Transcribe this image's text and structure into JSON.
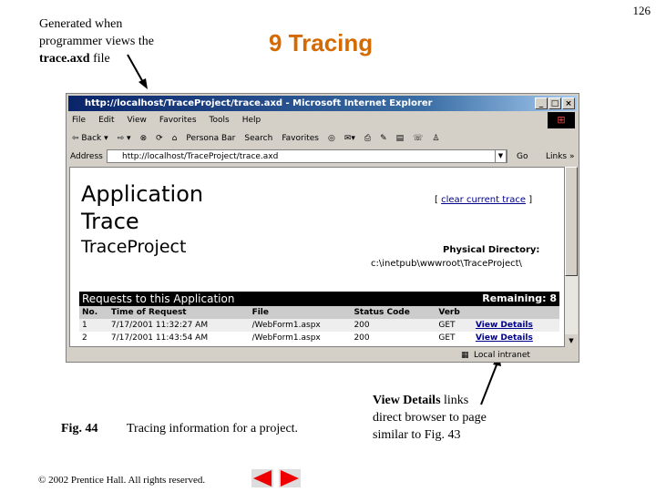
{
  "slide": {
    "page_number": "126",
    "title": "9  Tracing",
    "note_top": [
      "Generated when",
      "programmer views the"
    ],
    "note_top_bold": "trace.axd",
    "note_top_end": " file",
    "fig_label": "Fig. 44",
    "fig_caption": "Tracing information for a project.",
    "note_right_bold": "View Details",
    "note_right": [
      " links",
      "direct browser to page",
      "similar to Fig. 43"
    ],
    "copyright": "© 2002 Prentice Hall.  All rights reserved."
  },
  "browser": {
    "title": "http://localhost/TraceProject/trace.axd - Microsoft Internet Explorer",
    "menu": [
      "File",
      "Edit",
      "View",
      "Favorites",
      "Tools",
      "Help"
    ],
    "toolbar": [
      "⇦ Back ▾",
      "⇨ ▾",
      "⊗",
      "⟳",
      "⌂",
      "Persona Bar",
      "Search",
      "Favorites",
      "◎",
      "✉▾",
      "⎙",
      "✎",
      "▤",
      "☏",
      "♙"
    ],
    "address_label": "Address",
    "address": "http://localhost/TraceProject/trace.axd",
    "go": "Go",
    "links": "Links »",
    "status": "Local intranet"
  },
  "page": {
    "app_trace": "Application Trace",
    "project": "TraceProject",
    "clear_open": "[ ",
    "clear": "clear current trace",
    "clear_close": " ]",
    "phys_label": "Physical Directory:",
    "phys_path": "c:\\inetpub\\wwwroot\\TraceProject\\",
    "requests_title": "Requests to this Application",
    "remaining": "Remaining: 8",
    "headers": [
      "No.",
      "Time of Request",
      "File",
      "Status Code",
      "Verb",
      ""
    ],
    "rows": [
      [
        "1",
        "7/17/2001 11:32:27 AM",
        "/WebForm1.aspx",
        "200",
        "GET",
        "View Details"
      ],
      [
        "2",
        "7/17/2001 11:43:54 AM",
        "/WebForm1.aspx",
        "200",
        "GET",
        "View Details"
      ]
    ]
  }
}
